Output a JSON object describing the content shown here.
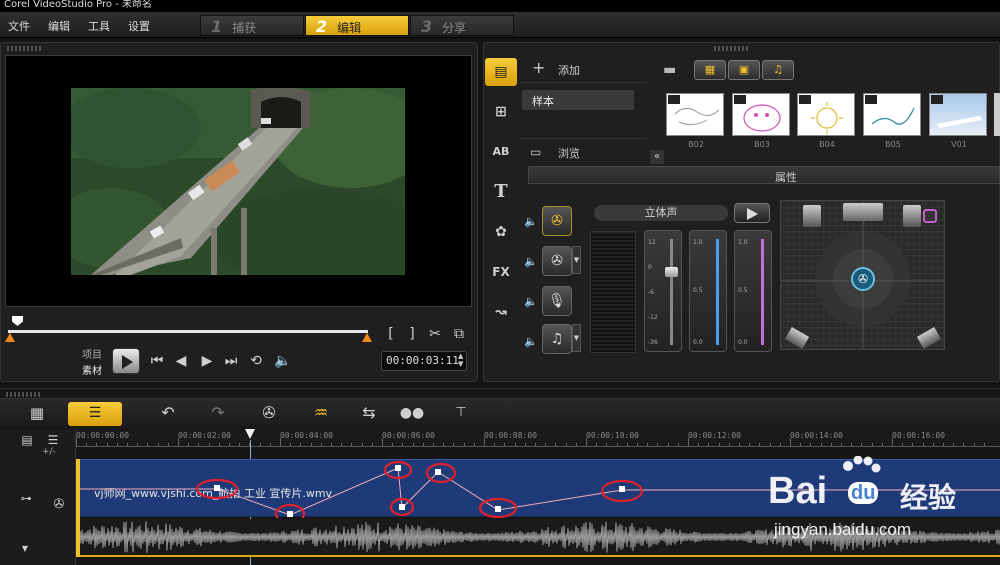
{
  "window": {
    "title": "Corel VideoStudio Pro - 未命名"
  },
  "menu": {
    "items": [
      "文件",
      "编辑",
      "工具",
      "设置"
    ]
  },
  "steps": [
    {
      "num": "1",
      "label": "捕获"
    },
    {
      "num": "2",
      "label": "编辑"
    },
    {
      "num": "3",
      "label": "分享"
    }
  ],
  "preview": {
    "mode_project": "项目",
    "mode_clip": "素材",
    "timecode": "00:00:03:11"
  },
  "library": {
    "add_label": "添加",
    "folder_selected": "样本",
    "browse_label": "浏览",
    "tabs": [
      "media-tab",
      "transition-tab",
      "title-tab-ab",
      "text-tab",
      "graphics-tab",
      "fx-tab",
      "path-tab"
    ],
    "thumbnails": [
      {
        "caption": "B02"
      },
      {
        "caption": "B03"
      },
      {
        "caption": "B04"
      },
      {
        "caption": "B05"
      },
      {
        "caption": "V01"
      }
    ]
  },
  "properties": {
    "header": "属性",
    "stereo_label": "立体声",
    "slider_scale_a": [
      "12",
      "0",
      "-6",
      "-12",
      "-36"
    ],
    "slider_scale_b": [
      "1.0",
      "0.5",
      "0.0"
    ],
    "slider_scale_c": [
      "1.0",
      "0.5",
      "0.0"
    ],
    "volume_level": 0.72
  },
  "timeline": {
    "ruler_labels": [
      "00:00:00:00",
      "00:00:02:00",
      "00:00:04:00",
      "00:00:06:00",
      "00:00:08:00",
      "00:00:10:00",
      "00:00:12:00",
      "00:00:14:00",
      "00:00:16:00"
    ],
    "clip_name": "vj师网_www.vjshi.com_航拍 工业 宣传片.wmv",
    "zoom_control": "+/-"
  },
  "watermark": {
    "brand": "Bai",
    "brand_paw": "du",
    "brand_cn": "经验",
    "url": "jingyan.baidu.com"
  },
  "colors": {
    "accent": "#f2c12e",
    "track_video": "#1f3a78",
    "keyframe_circle": "#e0202a",
    "scrubber_end": "#f08a1a"
  }
}
